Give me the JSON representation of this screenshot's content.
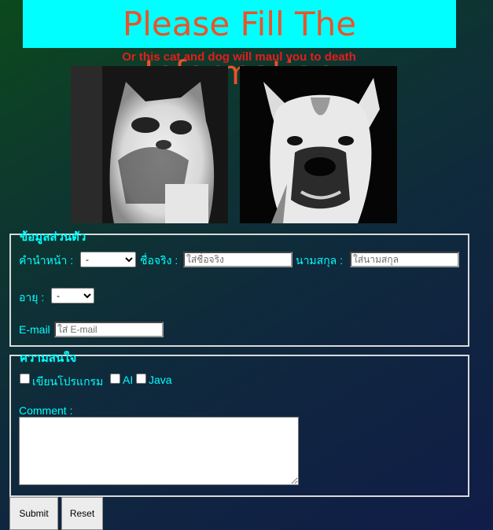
{
  "header": {
    "title": "Please Fill The Information",
    "subtitle": "Or this cat and dog will maul you to death"
  },
  "images": {
    "cat": "cat-photo",
    "dog": "dog-photo"
  },
  "personal": {
    "legend": "ข้อมูลส่วนตัว",
    "prefix_label": "คำนำหน้า :",
    "prefix_value": "-",
    "firstname_label": "ชื่อจริง :",
    "firstname_placeholder": "ใส่ชื่อจริง",
    "lastname_label": "นามสกุล :",
    "lastname_placeholder": "ใส่นามสกุล",
    "age_label": "อายุ :",
    "age_value": "-",
    "email_label": "E-mail",
    "email_placeholder": "ใส่ E-mail"
  },
  "interests": {
    "legend": "ความสนใจ",
    "options": [
      "เขียนโปรแกรม",
      "AI",
      "Java"
    ],
    "comment_label": "Comment :"
  },
  "buttons": {
    "submit": "Submit",
    "reset": "Reset"
  }
}
